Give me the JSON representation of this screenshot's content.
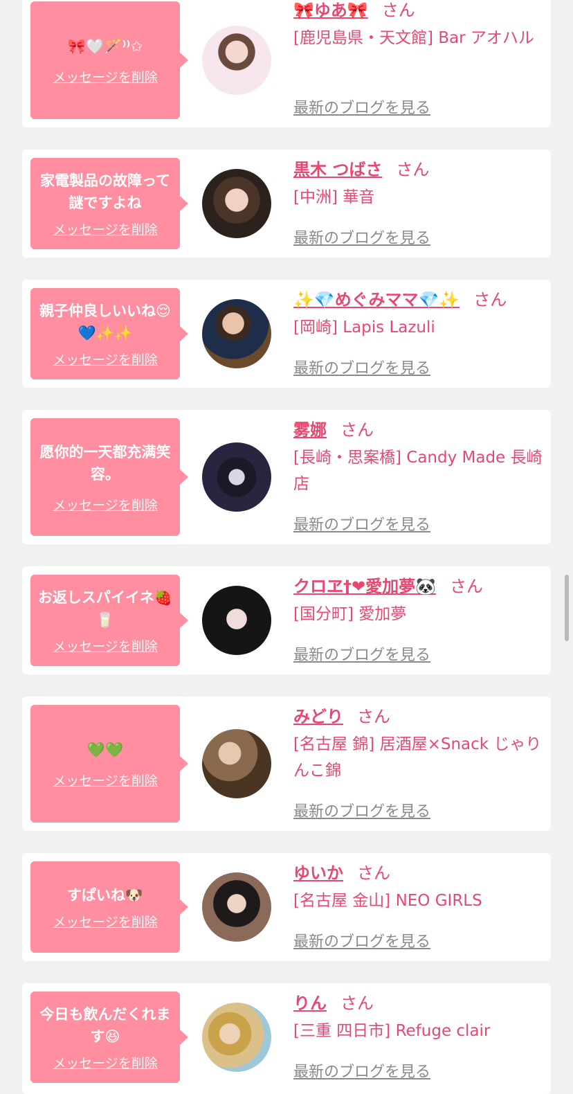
{
  "delete_label": "メッセージを削除",
  "san_label": "さん",
  "blog_label": "最新のブログを見る",
  "cards": [
    {
      "message": "🎀🤍🪄⁾⁾✩",
      "name": "🎀ゆあ🎀",
      "shop": "[鹿児島県・天文館] Bar アオハル"
    },
    {
      "message": "家電製品の故障って謎ですよね",
      "name": "黒木 つばさ",
      "shop": "[中洲] 華音"
    },
    {
      "message": "親子仲良しいいね😌💙✨✨",
      "name": "✨💎めぐみママ💎✨",
      "shop": "[岡崎] Lapis Lazuli"
    },
    {
      "message": "愿你的一天都充满笑容。",
      "name": "雾娜",
      "shop": "[長崎・思案橋] Candy Made 長崎店"
    },
    {
      "message": "お返しスパイイネ🍓🥛",
      "name": "クロヱ†❤愛加夢🐼",
      "shop": "[国分町] 愛加夢"
    },
    {
      "message": "💚💚",
      "name": "みどり",
      "shop": "[名古屋 錦] 居酒屋×Snack じゃりんこ錦"
    },
    {
      "message": "すぱいね🐶",
      "name": "ゆいか",
      "shop": "[名古屋 金山] NEO GIRLS"
    },
    {
      "message": "今日も飲んだくれます😆",
      "name": "りん",
      "shop": "[三重 四日市] Refuge clair"
    }
  ]
}
